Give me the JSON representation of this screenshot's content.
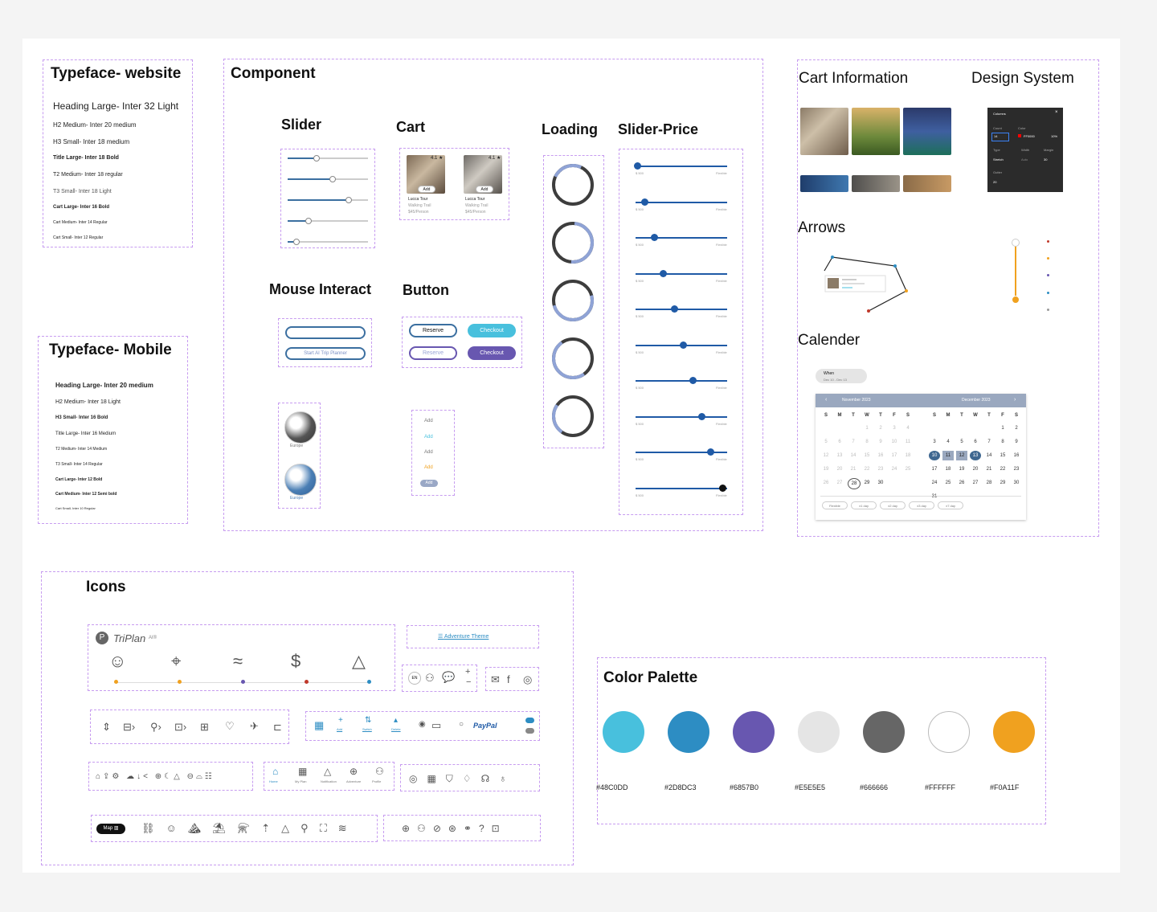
{
  "sections": {
    "typeface_website": "Typeface- website",
    "typeface_mobile": "Typeface- Mobile",
    "component": "Component",
    "slider": "Slider",
    "cart": "Cart",
    "loading": "Loading",
    "slider_price": "Slider-Price",
    "mouse_interact": "Mouse Interact",
    "button": "Button",
    "cart_information": "Cart Information",
    "design_system": "Design System",
    "arrows": "Arrows",
    "calender": "Calender",
    "icons": "Icons",
    "color_palette": "Color Palette"
  },
  "typeface_website": [
    "Heading Large- Inter 32 Light",
    "H2 Medium- Inter 20 medium",
    "H3 Small- Inter 18 medium",
    "Title Large- Inter 18 Bold",
    "T2 Medium- Inter 18 regular",
    "T3 Small- Inter 18 Light",
    "Cart Large- Inter 16 Bold",
    "Cart Medium- Inter 14 Regular",
    "Cart Small- Inter 12 Regular"
  ],
  "typeface_mobile": [
    "Heading Large- Inter 20 medium",
    "H2 Medium- Inter 18 Light",
    "H3 Small- Inter 16 Bold",
    "Title Large- Inter 16 Medium",
    "T2 Medium- Inter 14 Medium",
    "T3 Small- Inter 14 Regular",
    "Cart Large- Inter 12 Bold",
    "Cart Medium- Inter 12 Semi bold",
    "Cart Small- Inter 10 Regular"
  ],
  "sliders": [
    0.35,
    0.55,
    0.75,
    0.25,
    0.1
  ],
  "cart": {
    "rating": "4.1 ★",
    "add": "Add",
    "title": "Lucca Tour",
    "sub": "Walking Trail",
    "price": "$45/Person"
  },
  "mouse_interact": {
    "planner": "Start AI Trip Planner",
    "europe": "Europe"
  },
  "buttons": {
    "reserve": "Reserve",
    "checkout": "Checkout",
    "add_states": [
      "Add",
      "Add",
      "Add",
      "Add",
      "Add"
    ]
  },
  "loading_progress": [
    0.25,
    0.5,
    0.6,
    0.3,
    0.15
  ],
  "price_sliders": {
    "start": "$ 500",
    "end": "Flexible",
    "levels": [
      0.02,
      0.1,
      0.2,
      0.3,
      0.42,
      0.52,
      0.62,
      0.72,
      0.82,
      0.95
    ]
  },
  "design_system": {
    "panel_title": "Columns",
    "count_label": "Count",
    "count_value": "14",
    "color_label": "Color",
    "color_value": "FF0000",
    "opacity": "10%",
    "type_label": "Type",
    "type_value": "Stretch",
    "width_label": "Width",
    "width_value": "Auto",
    "margin_label": "Margin",
    "margin_value": "30",
    "gutter_label": "Gutter",
    "gutter_value": "20"
  },
  "calendar": {
    "when": "When",
    "range": "Dec 10 - Dec 13",
    "month_left": "November 2023",
    "month_right": "December 2023",
    "weekdays": [
      "S",
      "M",
      "T",
      "W",
      "T",
      "F",
      "S"
    ],
    "flex": [
      "Flexible",
      "±1 day",
      "±2 day",
      "±3 day",
      "±7 day"
    ]
  },
  "icons": {
    "brand": "TriPlan",
    "brand_suffix": "AI®",
    "theme": "Adventure Theme",
    "lang": "EN",
    "paypal": "PayPal",
    "map": "Map",
    "nav": [
      "Home",
      "My Plan",
      "Notification",
      "Adventure",
      "Profile"
    ],
    "mini": [
      "Add",
      "Switch",
      "Delete"
    ]
  },
  "palette": [
    {
      "hex": "#48C0DD",
      "color": "#48C0DD"
    },
    {
      "hex": "#2D8DC3",
      "color": "#2D8DC3"
    },
    {
      "hex": "#6857B0",
      "color": "#6857B0"
    },
    {
      "hex": "#E5E5E5",
      "color": "#E5E5E5"
    },
    {
      "hex": "#666666",
      "color": "#666666"
    },
    {
      "hex": "#FFFFFF",
      "color": "#FFFFFF"
    },
    {
      "hex": "#F0A11F",
      "color": "#F0A11F"
    }
  ]
}
